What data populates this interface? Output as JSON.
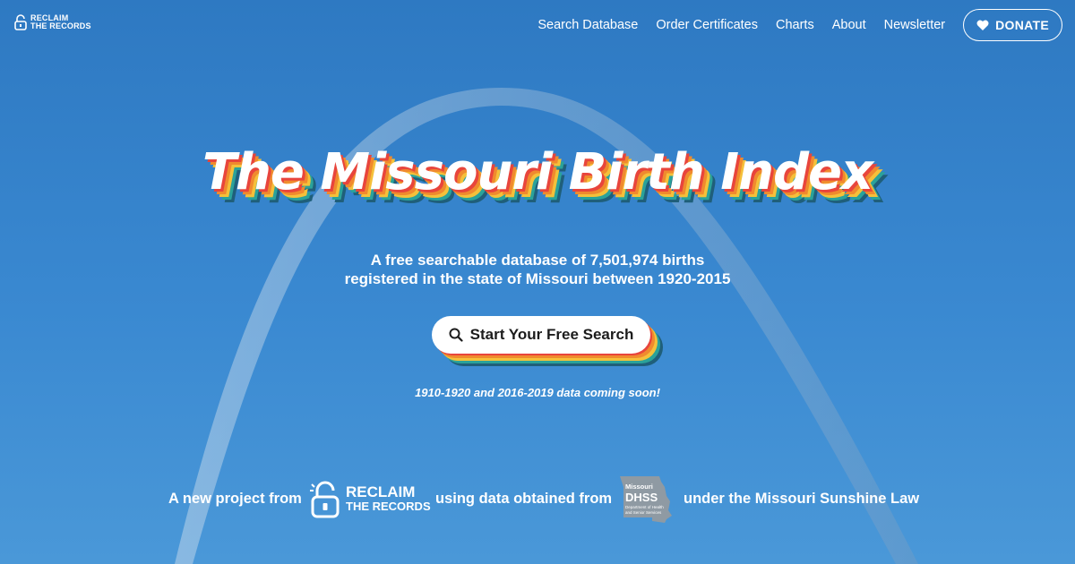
{
  "header": {
    "logo": {
      "line1": "RECLAIM",
      "line2": "THE RECORDS",
      "icon": "padlock-icon"
    },
    "nav": [
      {
        "label": "Search Database"
      },
      {
        "label": "Order Certificates"
      },
      {
        "label": "Charts"
      },
      {
        "label": "About"
      },
      {
        "label": "Newsletter"
      }
    ],
    "donate": {
      "label": "DONATE",
      "icon": "heart-icon"
    }
  },
  "hero": {
    "title": "The Missouri Birth Index",
    "subtitle_line1": "A free searchable database of 7,501,974 births",
    "subtitle_line2": "registered in the state of Missouri between 1920-2015",
    "cta_label": "Start Your Free Search",
    "cta_icon": "search-icon",
    "coming_soon": "1910-1920 and 2016-2019 data coming soon!"
  },
  "footer": {
    "prefix": "A new project from",
    "rtr_logo": {
      "line1": "RECLAIM",
      "line2": "THE RECORDS"
    },
    "middle": "using data obtained from",
    "dhss_logo": {
      "line1": "Missouri",
      "line2": "DHSS",
      "line3": "Department of Health",
      "line4": "and Senior Services"
    },
    "suffix": "under the Missouri Sunshine Law"
  },
  "colors": {
    "background": "#2e79c2",
    "shadow_stripes": [
      "#e8453c",
      "#f08a2e",
      "#f5c03a",
      "#2aa29a",
      "#1f5f7a"
    ]
  }
}
